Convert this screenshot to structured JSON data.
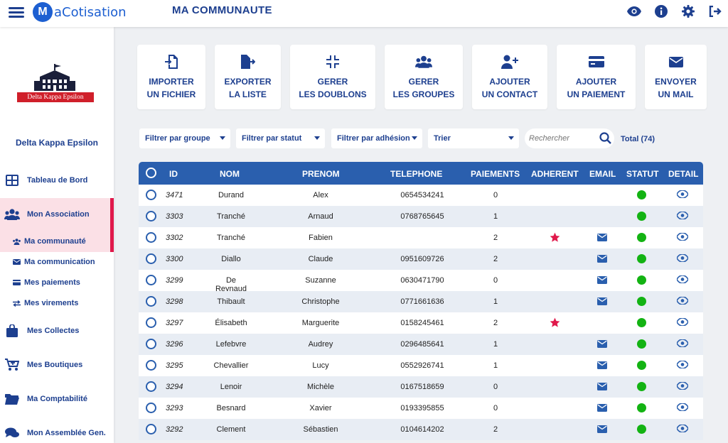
{
  "app": {
    "logo_text": "aCotisation",
    "logo_mark": "M",
    "page_title": "MA COMMUNAUTE"
  },
  "topbar_icons": [
    "eye-icon",
    "info-icon",
    "gear-icon",
    "logout-icon"
  ],
  "sidebar": {
    "org_name": "Delta Kappa Epsilon",
    "org_logo_text": "Delta Kappa Epsilon",
    "items": [
      {
        "label": "Tableau de Bord",
        "icon": "dashboard-icon"
      },
      {
        "label": "Mon Association",
        "icon": "users-icon"
      },
      {
        "label": "Ma communauté",
        "icon": "users-small-icon"
      },
      {
        "label": "Ma communication",
        "icon": "envelope-icon"
      },
      {
        "label": "Mes paiements",
        "icon": "card-icon"
      },
      {
        "label": "Mes virements",
        "icon": "transfer-icon"
      },
      {
        "label": "Mes Collectes",
        "icon": "bag-icon"
      },
      {
        "label": "Mes Boutiques",
        "icon": "cart-icon"
      },
      {
        "label": "Ma Comptabilité",
        "icon": "folder-icon"
      },
      {
        "label": "Mon Assemblée Gen.",
        "icon": "chat-icon"
      }
    ]
  },
  "actions": [
    {
      "line1": "IMPORTER",
      "line2": "UN FICHIER",
      "icon": "import-icon"
    },
    {
      "line1": "EXPORTER",
      "line2": "LA LISTE",
      "icon": "export-icon"
    },
    {
      "line1": "GERER",
      "line2": "LES DOUBLONS",
      "icon": "compress-icon"
    },
    {
      "line1": "GERER",
      "line2": "LES GROUPES",
      "icon": "group-icon"
    },
    {
      "line1": "AJOUTER",
      "line2": "UN CONTACT",
      "icon": "add-user-icon"
    },
    {
      "line1": "AJOUTER",
      "line2": "UN PAIEMENT",
      "icon": "credit-card-icon"
    },
    {
      "line1": "ENVOYER",
      "line2": "UN MAIL",
      "icon": "mail-icon"
    }
  ],
  "filters": {
    "group": "Filtrer par groupe",
    "status": "Filtrer par statut",
    "membership": "Filtrer par adhésion",
    "sort": "Trier",
    "search_placeholder": "Rechercher",
    "total": "Total (74)"
  },
  "table": {
    "headers": {
      "id": "ID",
      "nom": "NOM",
      "prenom": "PRENOM",
      "telephone": "TELEPHONE",
      "paiements": "PAIEMENTS",
      "adherent": "ADHERENT",
      "email": "EMAIL",
      "statut": "STATUT",
      "detail": "DETAIL"
    },
    "status_color": "#13b313",
    "star_color": "#e0194b",
    "rows": [
      {
        "id": "3471",
        "nom": "Durand",
        "prenom": "Alex",
        "tel": "0654534241",
        "pay": "0",
        "adherent": false,
        "email": false
      },
      {
        "id": "3303",
        "nom": "Tranché",
        "prenom": "Arnaud",
        "tel": "0768765645",
        "pay": "1",
        "adherent": false,
        "email": false
      },
      {
        "id": "3302",
        "nom": "Tranché",
        "prenom": "Fabien",
        "tel": "",
        "pay": "2",
        "adherent": true,
        "email": true
      },
      {
        "id": "3300",
        "nom": "Diallo",
        "prenom": "Claude",
        "tel": "0951609726",
        "pay": "2",
        "adherent": false,
        "email": true
      },
      {
        "id": "3299",
        "nom": "De Reynaud",
        "prenom": "Suzanne",
        "tel": "0630471790",
        "pay": "0",
        "adherent": false,
        "email": true
      },
      {
        "id": "3298",
        "nom": "Thibault",
        "prenom": "Christophe",
        "tel": "0771661636",
        "pay": "1",
        "adherent": false,
        "email": true
      },
      {
        "id": "3297",
        "nom": "Élisabeth",
        "prenom": "Marguerite",
        "tel": "0158245461",
        "pay": "2",
        "adherent": true,
        "email": false
      },
      {
        "id": "3296",
        "nom": "Lefebvre",
        "prenom": "Audrey",
        "tel": "0296485641",
        "pay": "1",
        "adherent": false,
        "email": true
      },
      {
        "id": "3295",
        "nom": "Chevallier",
        "prenom": "Lucy",
        "tel": "0552926741",
        "pay": "1",
        "adherent": false,
        "email": true
      },
      {
        "id": "3294",
        "nom": "Lenoir",
        "prenom": "Michèle",
        "tel": "0167518659",
        "pay": "0",
        "adherent": false,
        "email": true
      },
      {
        "id": "3293",
        "nom": "Besnard",
        "prenom": "Xavier",
        "tel": "0193395855",
        "pay": "0",
        "adherent": false,
        "email": true
      },
      {
        "id": "3292",
        "nom": "Clement",
        "prenom": "Sébastien",
        "tel": "0104614202",
        "pay": "2",
        "adherent": false,
        "email": true
      }
    ]
  }
}
